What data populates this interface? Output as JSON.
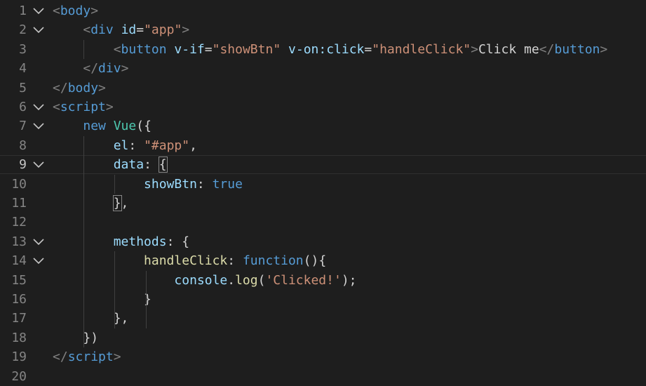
{
  "editor": {
    "current_line": 9,
    "lines": [
      {
        "n": "1",
        "fold": true,
        "tokens": [
          {
            "t": "<",
            "c": "tag-br"
          },
          {
            "t": "body",
            "c": "tag"
          },
          {
            "t": ">",
            "c": "tag-br"
          }
        ]
      },
      {
        "n": "2",
        "fold": true,
        "tokens": [
          {
            "t": "    ",
            "c": "txt"
          },
          {
            "t": "<",
            "c": "tag-br"
          },
          {
            "t": "div",
            "c": "tag"
          },
          {
            "t": " ",
            "c": "txt"
          },
          {
            "t": "id",
            "c": "attr"
          },
          {
            "t": "=",
            "c": "txt"
          },
          {
            "t": "\"app\"",
            "c": "str"
          },
          {
            "t": ">",
            "c": "tag-br"
          }
        ]
      },
      {
        "n": "3",
        "fold": false,
        "tokens": [
          {
            "t": "        ",
            "c": "txt"
          },
          {
            "t": "<",
            "c": "tag-br"
          },
          {
            "t": "button",
            "c": "tag"
          },
          {
            "t": " ",
            "c": "txt"
          },
          {
            "t": "v-if",
            "c": "attr"
          },
          {
            "t": "=",
            "c": "txt"
          },
          {
            "t": "\"showBtn\"",
            "c": "str"
          },
          {
            "t": " ",
            "c": "txt"
          },
          {
            "t": "v-on:click",
            "c": "attr"
          },
          {
            "t": "=",
            "c": "txt"
          },
          {
            "t": "\"handleClick\"",
            "c": "str"
          },
          {
            "t": ">",
            "c": "tag-br"
          },
          {
            "t": "Click me",
            "c": "txt"
          },
          {
            "t": "</",
            "c": "tag-br"
          },
          {
            "t": "button",
            "c": "tag"
          },
          {
            "t": ">",
            "c": "tag-br"
          }
        ]
      },
      {
        "n": "4",
        "fold": false,
        "tokens": [
          {
            "t": "    ",
            "c": "txt"
          },
          {
            "t": "</",
            "c": "tag-br"
          },
          {
            "t": "div",
            "c": "tag"
          },
          {
            "t": ">",
            "c": "tag-br"
          }
        ]
      },
      {
        "n": "5",
        "fold": false,
        "tokens": [
          {
            "t": "</",
            "c": "tag-br"
          },
          {
            "t": "body",
            "c": "tag"
          },
          {
            "t": ">",
            "c": "tag-br"
          }
        ]
      },
      {
        "n": "6",
        "fold": true,
        "tokens": [
          {
            "t": "<",
            "c": "tag-br"
          },
          {
            "t": "script",
            "c": "tag"
          },
          {
            "t": ">",
            "c": "tag-br"
          }
        ]
      },
      {
        "n": "7",
        "fold": true,
        "tokens": [
          {
            "t": "    ",
            "c": "txt"
          },
          {
            "t": "new",
            "c": "kw"
          },
          {
            "t": " ",
            "c": "txt"
          },
          {
            "t": "Vue",
            "c": "cls"
          },
          {
            "t": "({",
            "c": "punc"
          }
        ]
      },
      {
        "n": "8",
        "fold": false,
        "tokens": [
          {
            "t": "        ",
            "c": "txt"
          },
          {
            "t": "el",
            "c": "prop"
          },
          {
            "t": ": ",
            "c": "punc"
          },
          {
            "t": "\"#app\"",
            "c": "str"
          },
          {
            "t": ",",
            "c": "punc"
          }
        ]
      },
      {
        "n": "9",
        "fold": true,
        "tokens": [
          {
            "t": "        ",
            "c": "txt"
          },
          {
            "t": "data",
            "c": "prop"
          },
          {
            "t": ": ",
            "c": "punc"
          },
          {
            "t": "{",
            "c": "punc bm"
          }
        ]
      },
      {
        "n": "10",
        "fold": false,
        "tokens": [
          {
            "t": "            ",
            "c": "txt"
          },
          {
            "t": "showBtn",
            "c": "prop"
          },
          {
            "t": ": ",
            "c": "punc"
          },
          {
            "t": "true",
            "c": "kw"
          }
        ]
      },
      {
        "n": "11",
        "fold": false,
        "tokens": [
          {
            "t": "        ",
            "c": "txt"
          },
          {
            "t": "}",
            "c": "punc bm"
          },
          {
            "t": ",",
            "c": "punc"
          }
        ]
      },
      {
        "n": "12",
        "fold": false,
        "tokens": []
      },
      {
        "n": "13",
        "fold": true,
        "tokens": [
          {
            "t": "        ",
            "c": "txt"
          },
          {
            "t": "methods",
            "c": "prop"
          },
          {
            "t": ": {",
            "c": "punc"
          }
        ]
      },
      {
        "n": "14",
        "fold": true,
        "tokens": [
          {
            "t": "            ",
            "c": "txt"
          },
          {
            "t": "handleClick",
            "c": "fn"
          },
          {
            "t": ": ",
            "c": "punc"
          },
          {
            "t": "function",
            "c": "kw"
          },
          {
            "t": "(){",
            "c": "punc"
          }
        ]
      },
      {
        "n": "15",
        "fold": false,
        "tokens": [
          {
            "t": "                ",
            "c": "txt"
          },
          {
            "t": "console",
            "c": "prop"
          },
          {
            "t": ".",
            "c": "punc"
          },
          {
            "t": "log",
            "c": "fn"
          },
          {
            "t": "(",
            "c": "punc"
          },
          {
            "t": "'Clicked!'",
            "c": "str"
          },
          {
            "t": ");",
            "c": "punc"
          }
        ]
      },
      {
        "n": "16",
        "fold": false,
        "tokens": [
          {
            "t": "            ",
            "c": "txt"
          },
          {
            "t": "}",
            "c": "punc"
          }
        ]
      },
      {
        "n": "17",
        "fold": false,
        "tokens": [
          {
            "t": "        ",
            "c": "txt"
          },
          {
            "t": "},",
            "c": "punc"
          }
        ]
      },
      {
        "n": "18",
        "fold": false,
        "tokens": [
          {
            "t": "    ",
            "c": "txt"
          },
          {
            "t": "})",
            "c": "punc"
          }
        ]
      },
      {
        "n": "19",
        "fold": false,
        "tokens": [
          {
            "t": "</",
            "c": "tag-br"
          },
          {
            "t": "script",
            "c": "tag"
          },
          {
            "t": ">",
            "c": "tag-br"
          }
        ]
      },
      {
        "n": "20",
        "fold": false,
        "tokens": []
      }
    ]
  }
}
